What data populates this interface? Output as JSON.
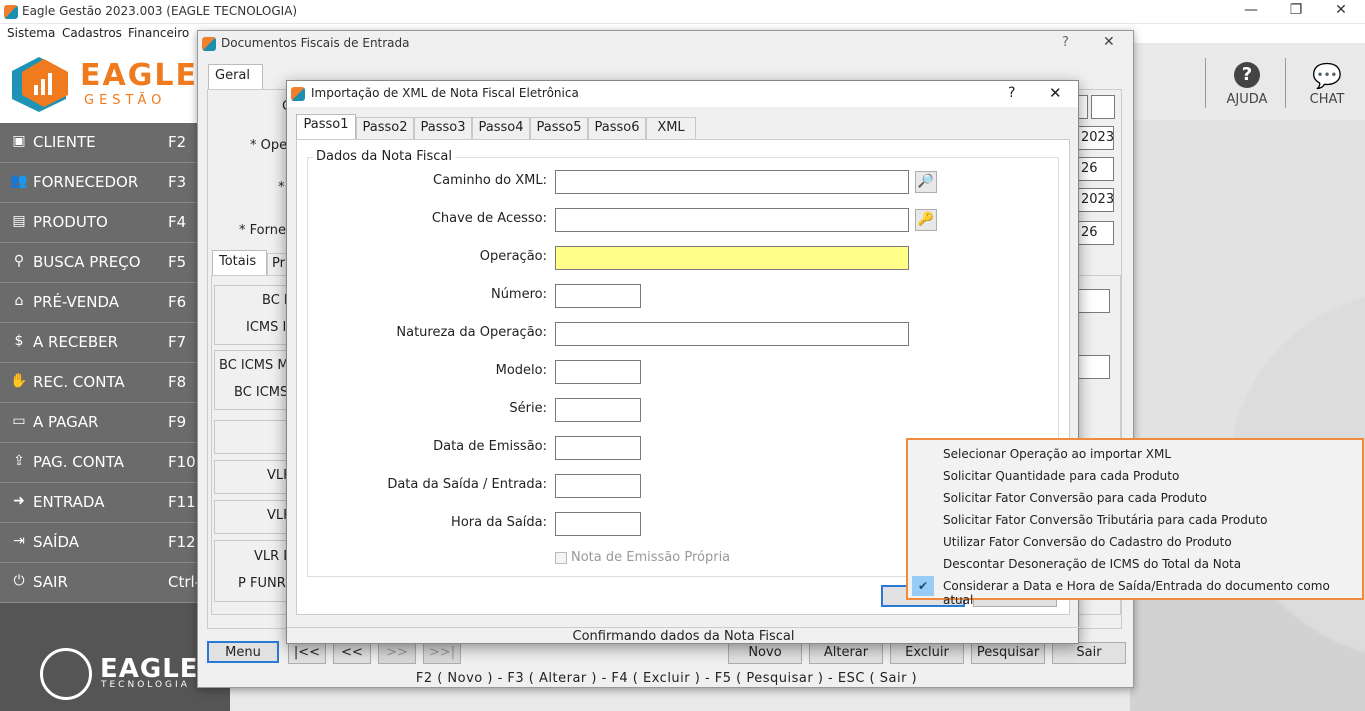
{
  "app": {
    "title": "Eagle Gestão 2023.003 (EAGLE TECNOLOGIA)",
    "menu": [
      "Sistema",
      "Cadastros",
      "Financeiro"
    ]
  },
  "logo": {
    "name": "EAGLE",
    "sub": "GESTÃO"
  },
  "sidebar": {
    "items": [
      {
        "label": "CLIENTE",
        "key": "F2",
        "icon": "id-card-icon"
      },
      {
        "label": "FORNECEDOR",
        "key": "F3",
        "icon": "users-icon"
      },
      {
        "label": "PRODUTO",
        "key": "F4",
        "icon": "box-icon"
      },
      {
        "label": "BUSCA PREÇO",
        "key": "F5",
        "icon": "search-icon"
      },
      {
        "label": "PRÉ-VENDA",
        "key": "F6",
        "icon": "basket-icon"
      },
      {
        "label": "A RECEBER",
        "key": "F7",
        "icon": "dollar-icon"
      },
      {
        "label": "REC. CONTA",
        "key": "F8",
        "icon": "hand-coin-icon"
      },
      {
        "label": "A PAGAR",
        "key": "F9",
        "icon": "wallet-icon"
      },
      {
        "label": "PAG. CONTA",
        "key": "F10",
        "icon": "upload-icon"
      },
      {
        "label": "ENTRADA",
        "key": "F11",
        "icon": "sign-in-icon"
      },
      {
        "label": "SAÍDA",
        "key": "F12",
        "icon": "sign-out-icon"
      },
      {
        "label": "SAIR",
        "key": "Ctrl-",
        "icon": "power-icon"
      }
    ],
    "brand": "EAGLE",
    "brand_sub": "TECNOLOGIA"
  },
  "rightbar": {
    "help": "AJUDA",
    "chat": "CHAT"
  },
  "docwin": {
    "title": "Documentos Fiscais de Entrada",
    "help": "?",
    "close": "✕",
    "tab": "Geral",
    "labels": {
      "ope": "* Ope",
      "star": "*",
      "forne": "* Forne",
      "c": "C"
    },
    "subtabs": [
      "Totais",
      "Pr"
    ],
    "totals": [
      "BC I",
      "ICMS I",
      "BC ICMS M",
      "BC ICMS",
      "VLF",
      "VLF",
      "VLR D",
      "P FUNRU"
    ],
    "right_values": [
      "2023",
      "26",
      "2023",
      "26"
    ],
    "nav": [
      "Menu",
      "|<<",
      "<<",
      ">>",
      ">>|"
    ],
    "actions": [
      "Novo",
      "Alterar",
      "Excluir",
      "Pesquisar",
      "Sair"
    ],
    "hotkeys": "F2 ( Novo )  -  F3 ( Alterar )  -  F4 ( Excluir )  -  F5 ( Pesquisar )  -  ESC ( Sair )"
  },
  "dialog": {
    "title": "Importação de XML de Nota Fiscal Eletrônica",
    "help": "?",
    "close": "✕",
    "tabs": [
      "Passo1",
      "Passo2",
      "Passo3",
      "Passo4",
      "Passo5",
      "Passo6",
      "XML"
    ],
    "group": "Dados da Nota Fiscal",
    "fields": {
      "caminho": "Caminho do XML:",
      "chave": "Chave de Acesso:",
      "operacao": "Operação:",
      "numero": "Número:",
      "natureza": "Natureza da Operação:",
      "modelo": "Modelo:",
      "serie": "Série:",
      "emissao": "Data de Emissão:",
      "saida": "Data da Saída / Entrada:",
      "hora": "Hora da Saída:"
    },
    "checkbox": "Nota de Emissão Própria",
    "status": "Confirmando dados da Nota Fiscal",
    "colors": {
      "operacao_bg": "#ffff88"
    }
  },
  "popup": {
    "items": [
      {
        "label": "Selecionar Operação ao importar XML",
        "checked": false
      },
      {
        "label": "Solicitar Quantidade para cada Produto",
        "checked": false
      },
      {
        "label": "Solicitar Fator Conversão para cada Produto",
        "checked": false
      },
      {
        "label": "Solicitar Fator Conversão Tributária para cada Produto",
        "checked": false
      },
      {
        "label": "Utilizar Fator Conversão do Cadastro do Produto",
        "checked": false
      },
      {
        "label": "Descontar Desoneração de ICMS do Total da Nota",
        "checked": false
      },
      {
        "label": "Considerar a Data e Hora de Saída/Entrada do documento como atual",
        "checked": true
      }
    ],
    "colors": {
      "border": "#f08a3c",
      "check_bg": "#99ccf5"
    }
  }
}
